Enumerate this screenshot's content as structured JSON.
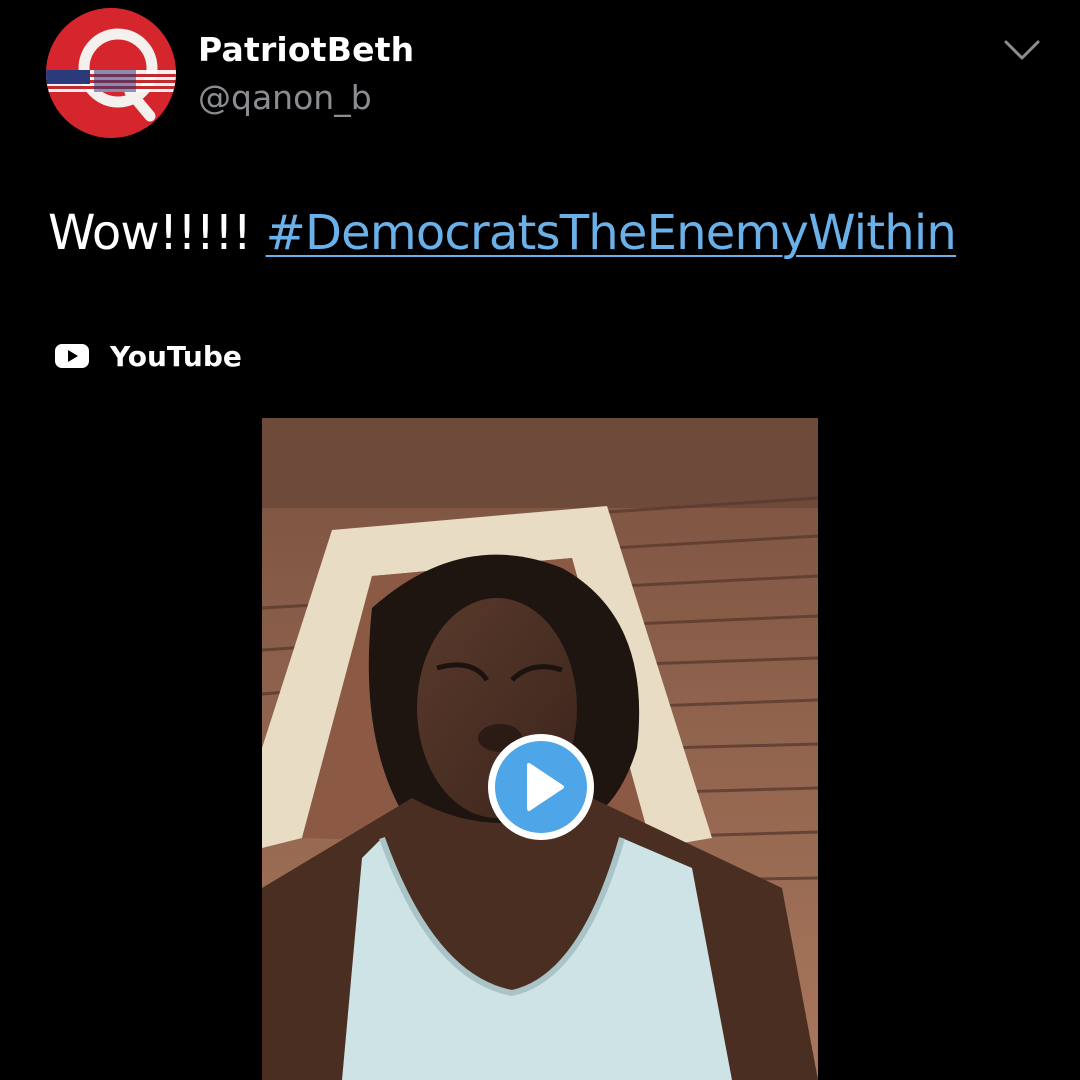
{
  "tweet": {
    "author": {
      "display_name": "PatriotBeth",
      "handle": "@qanon_b",
      "avatar_letter": "Q"
    },
    "text": "Wow!!!!!",
    "hashtag": "#DemocratsTheEnemyWithin",
    "card": {
      "source_icon": "youtube-icon",
      "source_label": "YouTube",
      "control_icon": "play-icon"
    },
    "menu_icon": "chevron-down-icon"
  },
  "colors": {
    "background": "#000000",
    "text": "#ffffff",
    "secondary_text": "#8a8d91",
    "link": "#6ab1ea",
    "play_button": "#4ea6e8",
    "avatar_bg": "#d6262d"
  }
}
